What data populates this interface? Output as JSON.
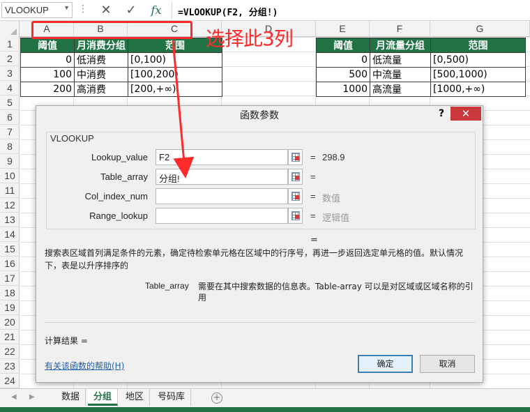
{
  "formula_bar": {
    "name_box": "VLOOKUP",
    "formula": "=VLOOKUP(F2, 分组!)",
    "fx_label": "fx"
  },
  "columns": [
    "A",
    "B",
    "C",
    "D",
    "E",
    "F",
    "G"
  ],
  "rows": [
    "1",
    "2",
    "3",
    "4",
    "5",
    "6",
    "7",
    "8",
    "9",
    "10",
    "11",
    "12",
    "13",
    "14",
    "15",
    "16",
    "17",
    "18",
    "19",
    "20",
    "21",
    "22",
    "23",
    "24"
  ],
  "table_left": {
    "headers": [
      "阈值",
      "月消费分组",
      "范围"
    ],
    "rows": [
      [
        "0",
        "低消费",
        "[0,100)"
      ],
      [
        "100",
        "中消费",
        "[100,200)"
      ],
      [
        "200",
        "高消费",
        "[200,+∞)"
      ]
    ]
  },
  "table_right": {
    "headers": [
      "阈值",
      "月流量分组",
      "范围"
    ],
    "rows": [
      [
        "0",
        "低流量",
        "[0,500)"
      ],
      [
        "500",
        "中流量",
        "[500,1000)"
      ],
      [
        "1000",
        "高流量",
        "[1000,+∞)"
      ]
    ]
  },
  "annotation": "选择此3列",
  "dialog": {
    "title": "函数参数",
    "help": "?",
    "close": "✕",
    "group_label": "VLOOKUP",
    "args": [
      {
        "label": "Lookup_value",
        "value": "F2",
        "result": "298.9",
        "muted": false
      },
      {
        "label": "Table_array",
        "value": "分组!",
        "result": "",
        "muted": false
      },
      {
        "label": "Col_index_num",
        "value": "",
        "result": "数值",
        "muted": true
      },
      {
        "label": "Range_lookup",
        "value": "",
        "result": "逻辑值",
        "muted": true
      }
    ],
    "eq": "=",
    "description": "搜索表区域首列满足条件的元素，确定待检索单元格在区域中的行序号，再进一步返回选定单元格的值。默认情况下，表是以升序排序的",
    "param_name": "Table_array",
    "param_desc": "需要在其中搜索数据的信息表。Table-array 可以是对区域或区域名称的引用",
    "calc_result": "计算结果 =",
    "help_link": "有关该函数的帮助(H)",
    "ok": "确定",
    "cancel": "取消"
  },
  "sheet_tabs": {
    "tabs": [
      "数据",
      "分组",
      "地区",
      "号码库"
    ],
    "active": "分组",
    "add": "+"
  },
  "colors": {
    "header_green": "#217346",
    "annotation_red": "#ff2a2a"
  }
}
